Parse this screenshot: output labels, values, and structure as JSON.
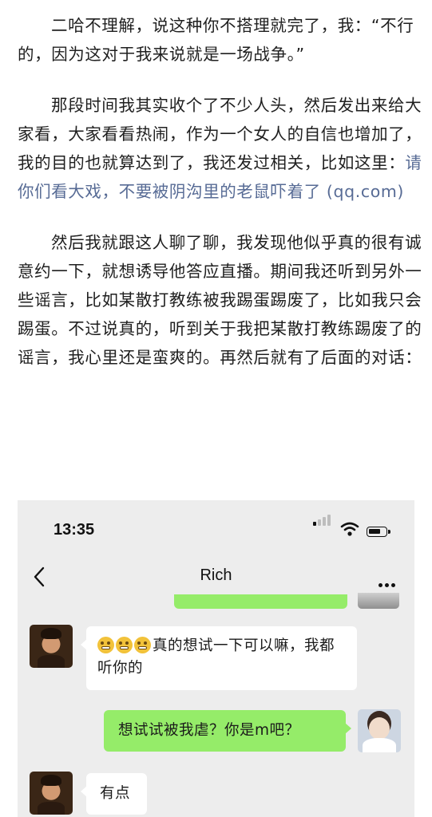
{
  "article": {
    "p1": "二哈不理解，说这种你不搭理就完了，我：“不行的，因为这对于我来说就是一场战争。”",
    "p2": "那段时间我其实收个了不少人头，然后发出来给大家看，大家看看热闹，作为一个女人的自信也增加了，我的目的也就算达到了，我还发过相关，比如这里：",
    "p2_link": "请你们看大戏，不要被阴沟里的老鼠吓着了 (qq.com)",
    "p3": "然后我就跟这人聊了聊，我发现他似乎真的很有诚意约一下，就想诱导他答应直播。期间我还听到另外一些谣言，比如某散打教练被我踢蛋踢废了，比如我只会踢蛋。不过说真的，听到关于我把某散打教练踢废了的谣言，我心里还是蛮爽的。再然后就有了后面的对话："
  },
  "screenshot": {
    "status_time": "13:35",
    "chat_title": "Rich",
    "messages": [
      {
        "side": "left",
        "emoji_count": 3,
        "text": "真的想试一下可以嘛，我都听你的"
      },
      {
        "side": "right",
        "text": "想试试被我虐？你是m吧？"
      },
      {
        "side": "left",
        "text": "有点"
      }
    ],
    "icons": [
      "signal-icon",
      "wifi-icon",
      "battery-icon",
      "back-arrow-icon",
      "more-icon"
    ],
    "colors": {
      "chat_bg": "#ededed",
      "green_bubble": "#95ec69",
      "link": "#576b95"
    }
  }
}
